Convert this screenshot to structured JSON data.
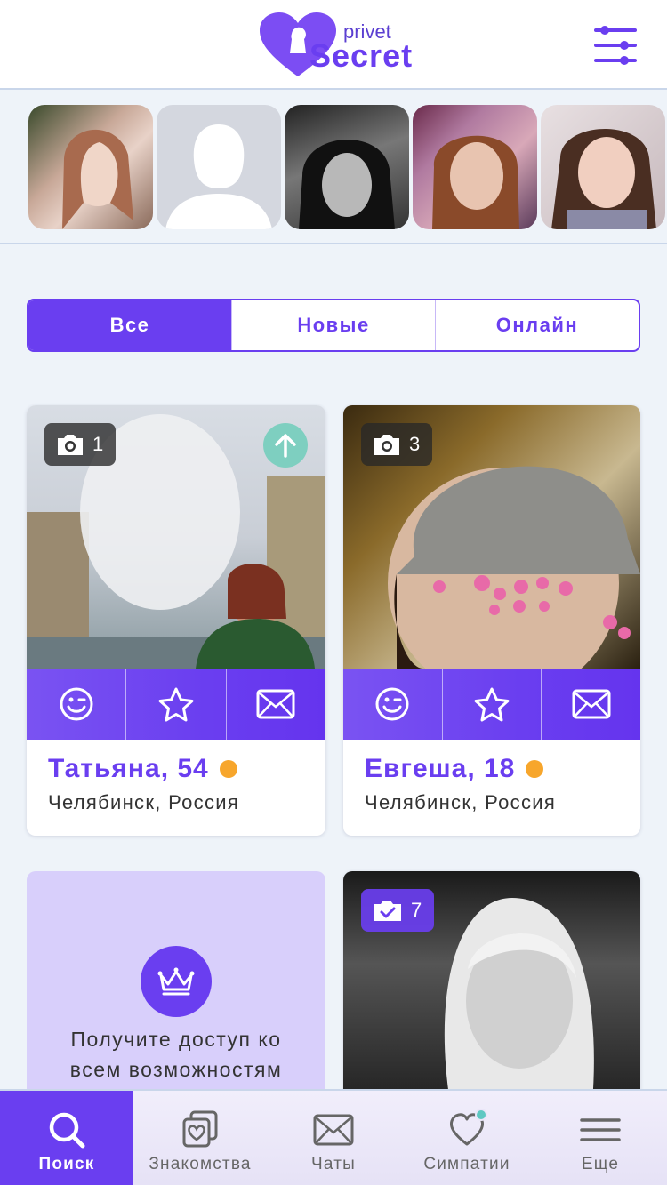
{
  "app": {
    "logo_top": "privet",
    "logo_main": "Secret",
    "brand_color": "#6a3ef0",
    "filter_icon": "sliders-icon"
  },
  "stories": [
    {
      "name": "story-1",
      "kind": "photo"
    },
    {
      "name": "story-2",
      "kind": "placeholder"
    },
    {
      "name": "story-3",
      "kind": "photo-bw"
    },
    {
      "name": "story-4",
      "kind": "photo"
    },
    {
      "name": "story-5",
      "kind": "photo"
    }
  ],
  "tabs": [
    {
      "label": "Все",
      "active": true
    },
    {
      "label": "Новые",
      "active": false
    },
    {
      "label": "Онлайн",
      "active": false
    }
  ],
  "cards": [
    {
      "photo_count": "1",
      "boost_icon": "arrow-up-icon",
      "name": "Татьяна, 54",
      "location": "Челябинск, Россия",
      "status_color": "#f7a62c"
    },
    {
      "photo_count": "3",
      "name": "Евгеша, 18",
      "location": "Челябинск, Россия",
      "status_color": "#f7a62c"
    },
    {
      "photo_count": "7",
      "verified": true
    }
  ],
  "card_actions": [
    "smile-icon",
    "star-icon",
    "mail-icon"
  ],
  "promo": {
    "line1": "Получите доступ ко",
    "line2": "всем возможностям",
    "icon": "crown-icon"
  },
  "nav": [
    {
      "label": "Поиск",
      "icon": "search-icon",
      "active": true
    },
    {
      "label": "Знакомства",
      "icon": "cards-heart-icon"
    },
    {
      "label": "Чаты",
      "icon": "mail-icon"
    },
    {
      "label": "Симпатии",
      "icon": "heart-icon",
      "notification": true
    },
    {
      "label": "Еще",
      "icon": "menu-icon"
    }
  ]
}
